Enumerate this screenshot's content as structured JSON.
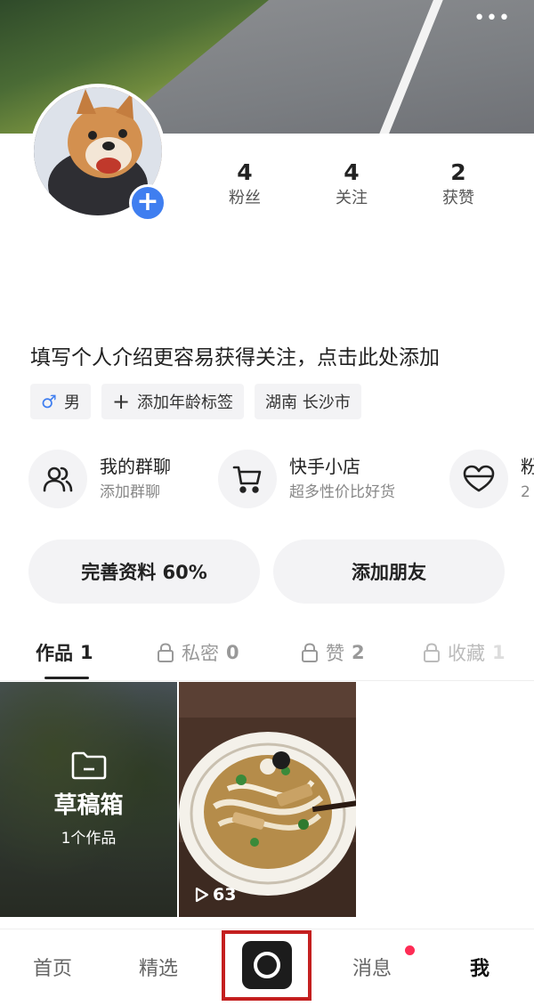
{
  "header": {
    "more_label": "•••"
  },
  "stats": [
    {
      "num": "4",
      "label": "粉丝"
    },
    {
      "num": "4",
      "label": "关注"
    },
    {
      "num": "2",
      "label": "获赞"
    }
  ],
  "bio": "填写个人介绍更容易获得关注，点击此处添加",
  "tags": {
    "gender_symbol": "♂",
    "gender": "男",
    "age": "添加年龄标签",
    "location": "湖南 长沙市"
  },
  "features": [
    {
      "title": "我的群聊",
      "subtitle": "添加群聊",
      "icon": "group-icon"
    },
    {
      "title": "快手小店",
      "subtitle": "超多性价比好货",
      "icon": "cart-icon"
    },
    {
      "title": "粉",
      "subtitle": "2",
      "icon": "heart-icon"
    }
  ],
  "actions": {
    "complete_profile": "完善资料 60%",
    "add_friend": "添加朋友"
  },
  "tabs": [
    {
      "label": "作品",
      "count": "1"
    },
    {
      "label": "私密",
      "count": "0"
    },
    {
      "label": "赞",
      "count": "2"
    },
    {
      "label": "收藏",
      "count": "1"
    }
  ],
  "grid": {
    "draft_title": "草稿箱",
    "draft_sub": "1个作品",
    "video_views": "63"
  },
  "nav": {
    "home": "首页",
    "featured": "精选",
    "messages": "消息",
    "me": "我"
  },
  "colors": {
    "accent_blue": "#3f7ef0",
    "highlight_red": "#c41f1f",
    "badge_pink": "#fe2c55"
  }
}
